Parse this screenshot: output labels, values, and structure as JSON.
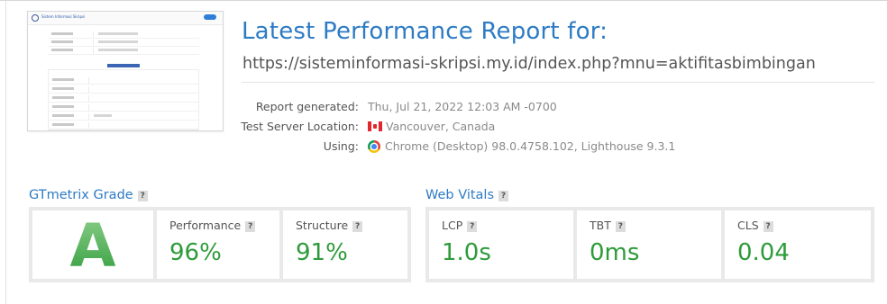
{
  "report": {
    "title": "Latest Performance Report for:",
    "url": "https://sisteminformasi-skripsi.my.id/index.php?mnu=aktifitasbimbingan"
  },
  "meta": {
    "generated_label": "Report generated:",
    "generated_value": "Thu, Jul 21, 2022 12:03 AM -0700",
    "location_label": "Test Server Location:",
    "location_value": "Vancouver, Canada",
    "location_icon": "canada-flag-icon",
    "using_label": "Using:",
    "using_value": "Chrome (Desktop) 98.0.4758.102, Lighthouse 9.3.1",
    "using_icon": "chrome-icon"
  },
  "grade": {
    "section_title": "GTmetrix Grade",
    "help": "?",
    "letter": "A",
    "performance_label": "Performance",
    "performance_value": "96%",
    "structure_label": "Structure",
    "structure_value": "91%"
  },
  "vitals": {
    "section_title": "Web Vitals",
    "help": "?",
    "lcp_label": "LCP",
    "lcp_value": "1.0s",
    "tbt_label": "TBT",
    "tbt_value": "0ms",
    "cls_label": "CLS",
    "cls_value": "0.04"
  },
  "thumbnail": {
    "site_title": "Sistem Informasi Skripsi"
  },
  "colors": {
    "accent": "#2d7bc4",
    "good": "#2e9b3a",
    "panel_bg": "#e9e9e9"
  }
}
